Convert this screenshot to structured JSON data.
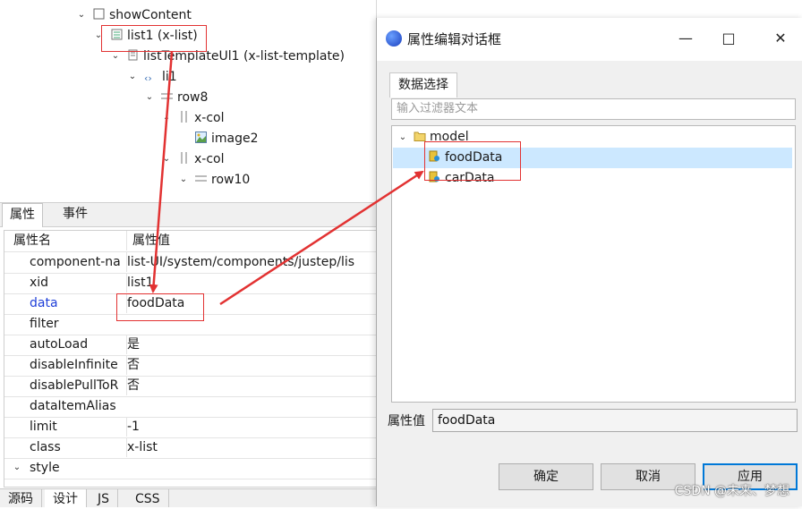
{
  "tree": {
    "nodes": [
      {
        "label": "showContent",
        "icon": "square-icon"
      },
      {
        "label": "list1 (x-list)",
        "icon": "list-icon"
      },
      {
        "label": "listTemplateUl1 (x-list-template)",
        "icon": "doc-icon"
      },
      {
        "label": "li1",
        "icon": "code-icon"
      },
      {
        "label": "row8",
        "icon": "row-icon"
      },
      {
        "label": "x-col",
        "icon": "col-icon"
      },
      {
        "label": "image2",
        "icon": "image-icon"
      },
      {
        "label": "x-col",
        "icon": "col-icon"
      },
      {
        "label": "row10",
        "icon": "row-icon"
      }
    ]
  },
  "properties": {
    "tabs": [
      "属性",
      "事件"
    ],
    "header": {
      "name": "属性名",
      "value": "属性值"
    },
    "rows": [
      {
        "name": "component-na",
        "value": "list-UI/system/components/justep/lis"
      },
      {
        "name": "xid",
        "value": "list1"
      },
      {
        "name": "data",
        "value": "foodData",
        "highlight": "#1f3fd8"
      },
      {
        "name": "filter",
        "value": ""
      },
      {
        "name": "autoLoad",
        "value": "是"
      },
      {
        "name": "disableInfinite",
        "value": "否"
      },
      {
        "name": "disablePullToR",
        "value": "否"
      },
      {
        "name": "dataItemAlias",
        "value": ""
      },
      {
        "name": "limit",
        "value": "-1"
      },
      {
        "name": "class",
        "value": "x-list"
      },
      {
        "name": "style",
        "value": ""
      }
    ]
  },
  "editor_tabs": [
    "源码",
    "设计",
    "JS",
    "CSS"
  ],
  "dialog": {
    "title": "属性编辑对话框",
    "minimize": "—",
    "maximize": "□",
    "close": "✕",
    "tab": "数据选择",
    "filter_placeholder": "输入过滤器文本",
    "tree": [
      {
        "label": "model",
        "icon": "folder-icon"
      },
      {
        "label": "foodData",
        "icon": "data-icon",
        "selected": true
      },
      {
        "label": "carData",
        "icon": "data-icon"
      }
    ],
    "value_label": "属性值",
    "value": "foodData",
    "buttons": {
      "ok": "确定",
      "cancel": "取消",
      "apply": "应用"
    }
  },
  "watermark": "CSDN @未来、梦想",
  "colors": {
    "annotation_red": "#e23232",
    "selection": "#cce8ff",
    "link_blue": "#1f3fd8"
  }
}
